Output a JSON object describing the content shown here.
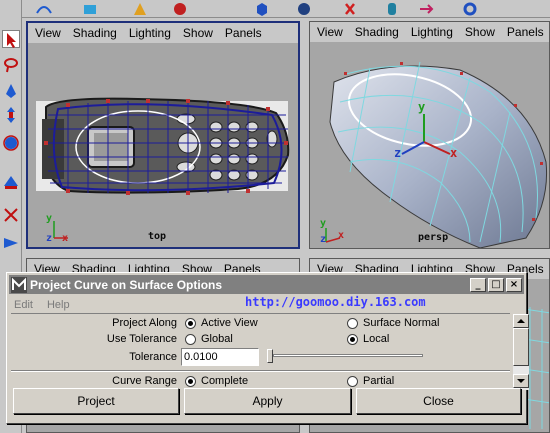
{
  "viewports": {
    "menu": [
      "View",
      "Shading",
      "Lighting",
      "Show",
      "Panels"
    ],
    "top_left_label": "top",
    "top_right_label": "persp",
    "axis_x": "x",
    "axis_y": "y",
    "axis_z": "z"
  },
  "dialog": {
    "title": "Project Curve on Surface Options",
    "menu": {
      "edit": "Edit",
      "help": "Help"
    },
    "watermark": "http://goomoo.diy.163.com",
    "project_along": {
      "label": "Project Along",
      "option_active": "Active View",
      "option_surface": "Surface Normal",
      "selected": "Active View"
    },
    "use_tolerance": {
      "label": "Use Tolerance",
      "option_global": "Global",
      "option_local": "Local",
      "selected": "Local"
    },
    "tolerance": {
      "label": "Tolerance",
      "value": "0.0100"
    },
    "curve_range": {
      "label": "Curve Range",
      "option_complete": "Complete",
      "option_partial": "Partial",
      "selected": "Complete"
    },
    "buttons": {
      "project": "Project",
      "apply": "Apply",
      "close": "Close"
    },
    "window_controls": {
      "minimize": "_",
      "maximize": "□",
      "close": "×"
    }
  },
  "colors": {
    "active_border": "#1e2f7a",
    "watermark": "#3a3aff",
    "nurbs_surface": "#7fd8e0"
  }
}
